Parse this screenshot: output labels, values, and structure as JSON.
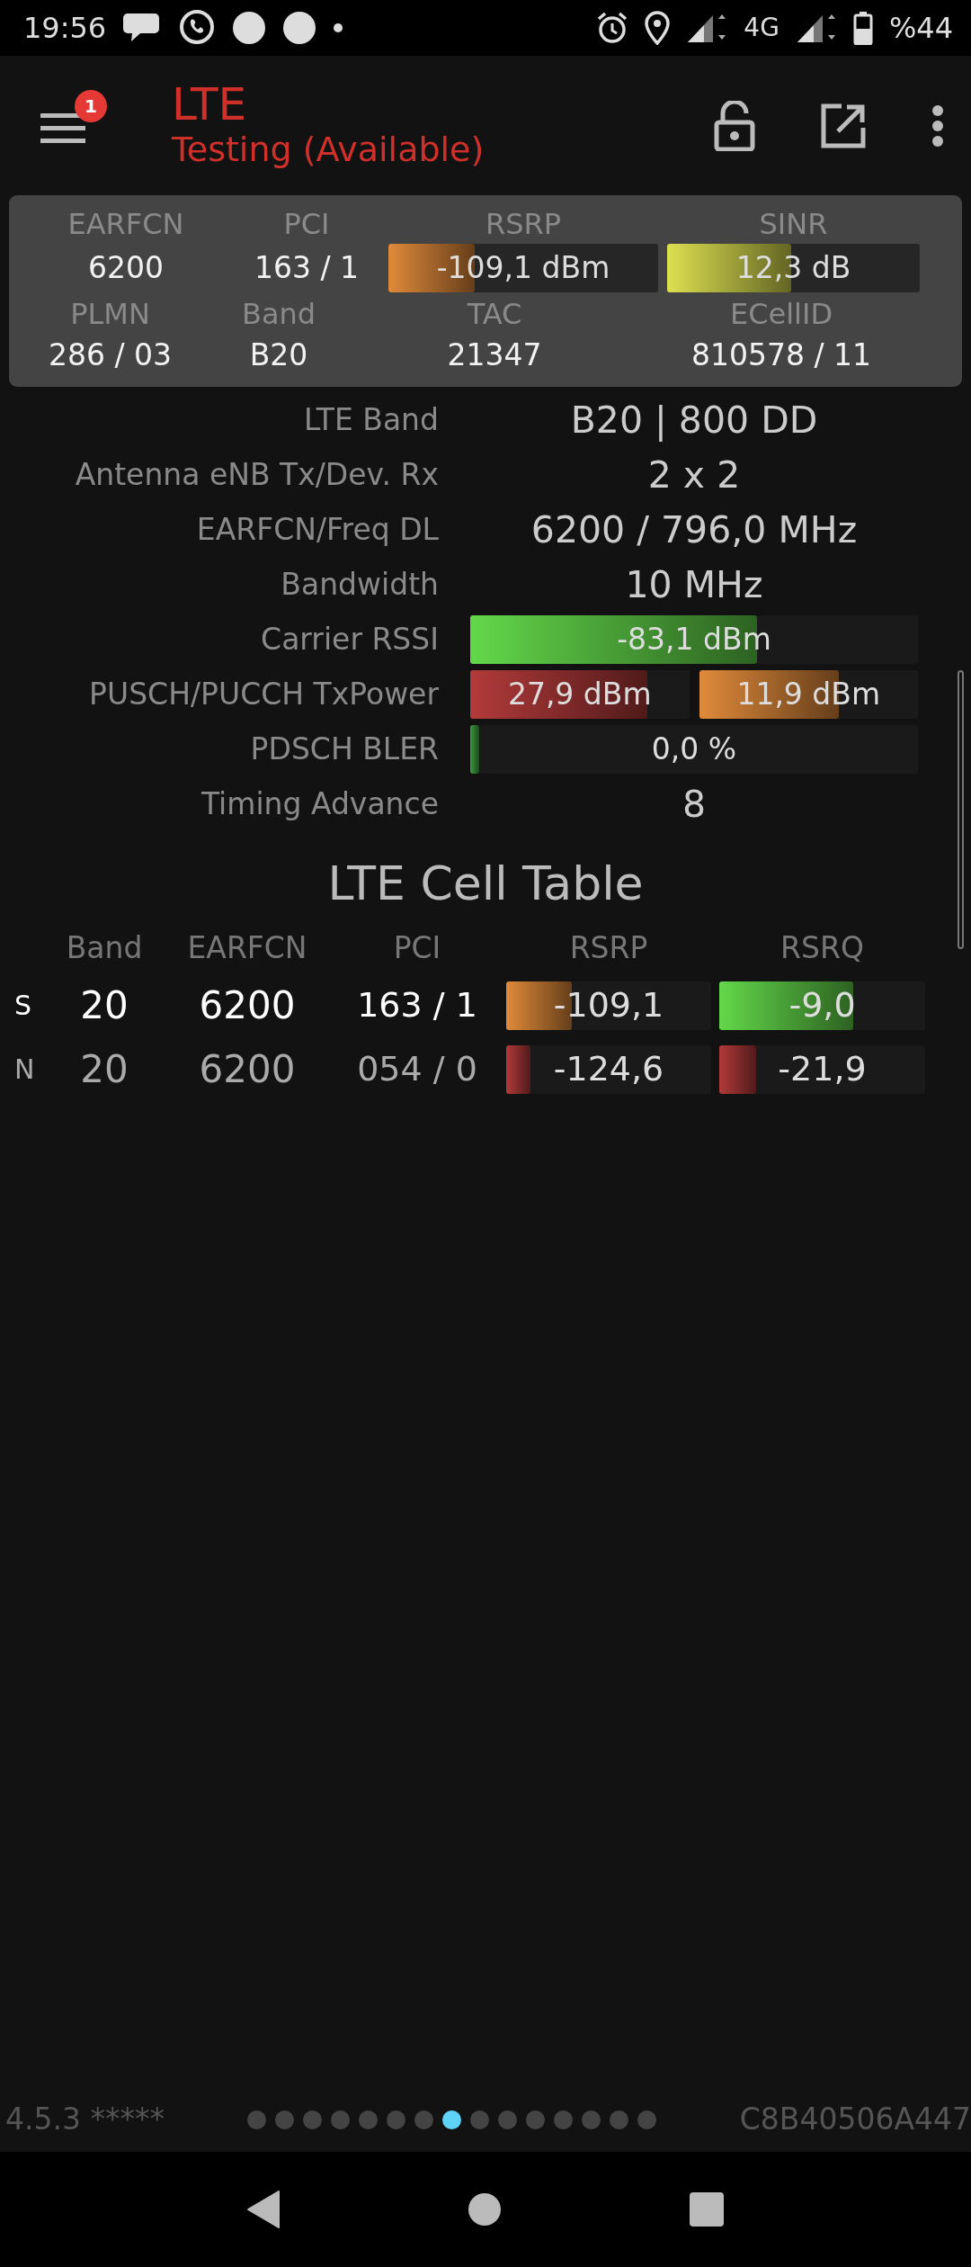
{
  "status_bar": {
    "time": "19:56",
    "network": "4G",
    "battery": "%44"
  },
  "header": {
    "badge": "1",
    "title": "LTE",
    "subtitle": "Testing (Available)"
  },
  "summary": {
    "top": [
      {
        "label": "EARFCN",
        "value": "6200"
      },
      {
        "label": "PCI",
        "value": "163 / 1"
      },
      {
        "label": "RSRP",
        "bar": {
          "text": "-109,1 dBm",
          "level": 0.32,
          "color": "#e08a3a"
        }
      },
      {
        "label": "SINR",
        "bar": {
          "text": "12,3 dB",
          "level": 0.49,
          "color": "#dde050"
        }
      }
    ],
    "bottom": [
      {
        "label": "PLMN",
        "value": "286 / 03"
      },
      {
        "label": "Band",
        "value": "B20"
      },
      {
        "label": "TAC",
        "value": "21347"
      },
      {
        "label": "ECellID",
        "value": "810578 / 11"
      }
    ]
  },
  "details": [
    {
      "label": "LTE Band",
      "kind": "text",
      "value": "B20 | 800 DD"
    },
    {
      "label": "Antenna eNB Tx/Dev. Rx",
      "kind": "text",
      "value": "2 x 2"
    },
    {
      "label": "EARFCN/Freq DL",
      "kind": "text",
      "value": "6200 / 796,0 MHz"
    },
    {
      "label": "Bandwidth",
      "kind": "text",
      "value": "10 MHz"
    },
    {
      "label": "Carrier RSSI",
      "kind": "bar",
      "bars": [
        {
          "text": "-83,1 dBm",
          "level": 0.64,
          "color": "#63d84a"
        }
      ]
    },
    {
      "label": "PUSCH/PUCCH TxPower",
      "kind": "bar",
      "bars": [
        {
          "text": "27,9 dBm",
          "level": 0.81,
          "color": "#b33a3a"
        },
        {
          "text": "11,9 dBm",
          "level": 0.64,
          "color": "#e08a3a"
        }
      ]
    },
    {
      "label": "PDSCH BLER",
      "kind": "bar",
      "bars": [
        {
          "text": "0,0 %",
          "level": 0.02,
          "color": "#3f9a3f"
        }
      ]
    },
    {
      "label": "Timing Advance",
      "kind": "text",
      "value": "8"
    }
  ],
  "cell_table": {
    "title": "LTE Cell Table",
    "columns": [
      "Band",
      "EARFCN",
      "PCI",
      "RSRP",
      "RSRQ"
    ],
    "rows": [
      {
        "kind": "serving",
        "type": "S",
        "band": "20",
        "earfcn": "6200",
        "pci": "163 / 1",
        "rsrp": {
          "text": "-109,1",
          "level": 0.32,
          "color": "#e08a3a"
        },
        "rsrq": {
          "text": "-9,0",
          "level": 0.65,
          "color": "#63d84a"
        }
      },
      {
        "kind": "neighbor",
        "type": "N",
        "band": "20",
        "earfcn": "6200",
        "pci": "054 / 0",
        "rsrp": {
          "text": "-124,6",
          "level": 0.12,
          "color": "#b33a3a"
        },
        "rsrq": {
          "text": "-21,9",
          "level": 0.18,
          "color": "#b33a3a"
        }
      }
    ]
  },
  "footer": {
    "version": "4.5.3 *****",
    "device_id": "C8B40506A447",
    "pager": [
      {
        "selected": false
      },
      {
        "selected": false
      },
      {
        "selected": false
      },
      {
        "selected": false
      },
      {
        "selected": false
      },
      {
        "selected": false
      },
      {
        "selected": false
      },
      {
        "selected": true
      },
      {
        "selected": false
      },
      {
        "selected": false
      },
      {
        "selected": false
      },
      {
        "selected": false
      },
      {
        "selected": false
      },
      {
        "selected": false
      },
      {
        "selected": false
      }
    ]
  }
}
